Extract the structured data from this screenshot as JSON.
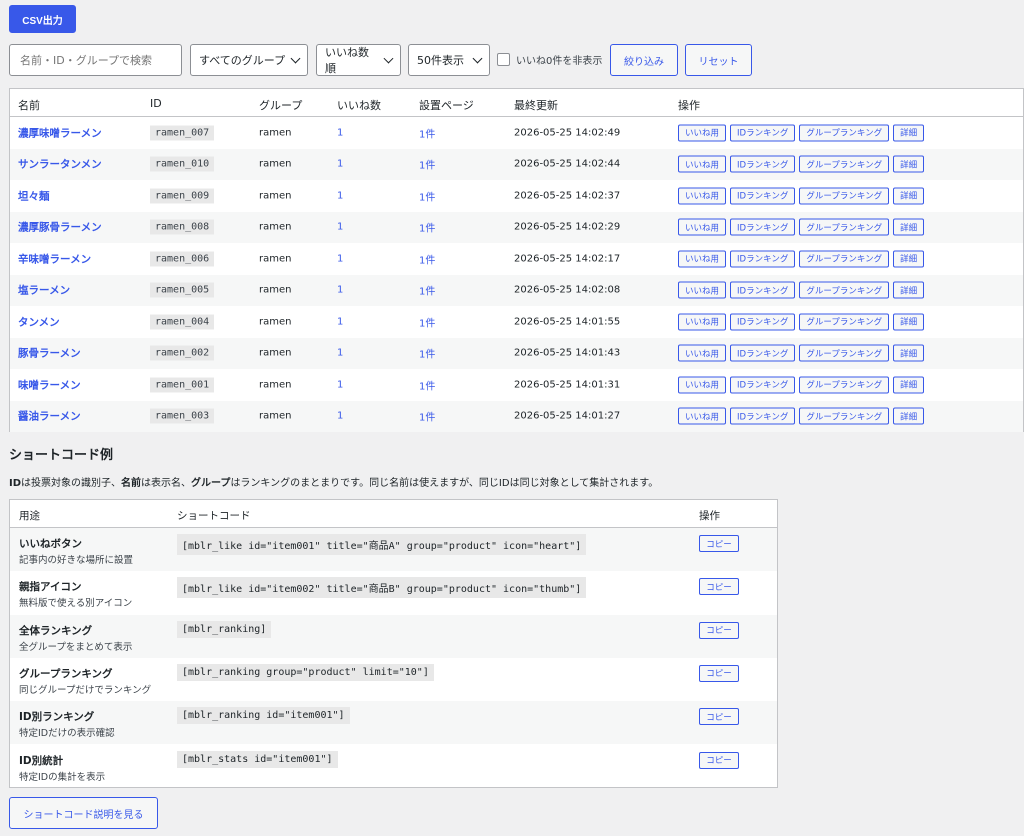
{
  "toolbar": {
    "csv_label": "CSV出力"
  },
  "filters": {
    "search_placeholder": "名前・ID・グループで検索",
    "group_select": "すべてのグループ",
    "sort_select": "いいね数順",
    "per_page_select": "50件表示",
    "hide_zero_label": "いいね0件を非表示",
    "filter_button": "絞り込み",
    "reset_button": "リセット"
  },
  "table": {
    "headers": [
      "名前",
      "ID",
      "グループ",
      "いいね数",
      "設置ページ",
      "最終更新",
      "操作"
    ],
    "op_labels": [
      "いいね用",
      "IDランキング",
      "グループランキング",
      "詳細"
    ],
    "rows": [
      {
        "name": "濃厚味噌ラーメン",
        "id": "ramen_007",
        "group": "ramen",
        "likes": "1",
        "pages": "1件",
        "updated": "2026-05-25 14:02:49"
      },
      {
        "name": "サンラータンメン",
        "id": "ramen_010",
        "group": "ramen",
        "likes": "1",
        "pages": "1件",
        "updated": "2026-05-25 14:02:44"
      },
      {
        "name": "坦々麺",
        "id": "ramen_009",
        "group": "ramen",
        "likes": "1",
        "pages": "1件",
        "updated": "2026-05-25 14:02:37"
      },
      {
        "name": "濃厚豚骨ラーメン",
        "id": "ramen_008",
        "group": "ramen",
        "likes": "1",
        "pages": "1件",
        "updated": "2026-05-25 14:02:29"
      },
      {
        "name": "辛味噌ラーメン",
        "id": "ramen_006",
        "group": "ramen",
        "likes": "1",
        "pages": "1件",
        "updated": "2026-05-25 14:02:17"
      },
      {
        "name": "塩ラーメン",
        "id": "ramen_005",
        "group": "ramen",
        "likes": "1",
        "pages": "1件",
        "updated": "2026-05-25 14:02:08"
      },
      {
        "name": "タンメン",
        "id": "ramen_004",
        "group": "ramen",
        "likes": "1",
        "pages": "1件",
        "updated": "2026-05-25 14:01:55"
      },
      {
        "name": "豚骨ラーメン",
        "id": "ramen_002",
        "group": "ramen",
        "likes": "1",
        "pages": "1件",
        "updated": "2026-05-25 14:01:43"
      },
      {
        "name": "味噌ラーメン",
        "id": "ramen_001",
        "group": "ramen",
        "likes": "1",
        "pages": "1件",
        "updated": "2026-05-25 14:01:31"
      },
      {
        "name": "醤油ラーメン",
        "id": "ramen_003",
        "group": "ramen",
        "likes": "1",
        "pages": "1件",
        "updated": "2026-05-25 14:01:27"
      }
    ]
  },
  "shortcodes": {
    "title": "ショートコード例",
    "description_parts": [
      "ID",
      "は投票対象の識別子、",
      "名前",
      "は表示名、",
      "グループ",
      "はランキングのまとまりです。同じ名前は使えますが、同じIDは同じ対象として集計されます。"
    ],
    "headers": [
      "用途",
      "ショートコード",
      "操作"
    ],
    "copy_label": "コピー",
    "rows": [
      {
        "label": "いいねボタン",
        "sub": "記事内の好きな場所に設置",
        "code": "[mblr_like id=\"item001\" title=\"商品A\" group=\"product\" icon=\"heart\"]"
      },
      {
        "label": "親指アイコン",
        "sub": "無料版で使える別アイコン",
        "code": "[mblr_like id=\"item002\" title=\"商品B\" group=\"product\" icon=\"thumb\"]"
      },
      {
        "label": "全体ランキング",
        "sub": "全グループをまとめて表示",
        "code": "[mblr_ranking]"
      },
      {
        "label": "グループランキング",
        "sub": "同じグループだけでランキング",
        "code": "[mblr_ranking group=\"product\" limit=\"10\"]"
      },
      {
        "label": "ID別ランキング",
        "sub": "特定IDだけの表示確認",
        "code": "[mblr_ranking id=\"item001\"]"
      },
      {
        "label": "ID別統計",
        "sub": "特定IDの集計を表示",
        "code": "[mblr_stats id=\"item001\"]"
      }
    ],
    "help_button": "ショートコード説明を見る"
  },
  "colors": {
    "accent": "#3858e9",
    "bg": "#f0f0f1"
  }
}
